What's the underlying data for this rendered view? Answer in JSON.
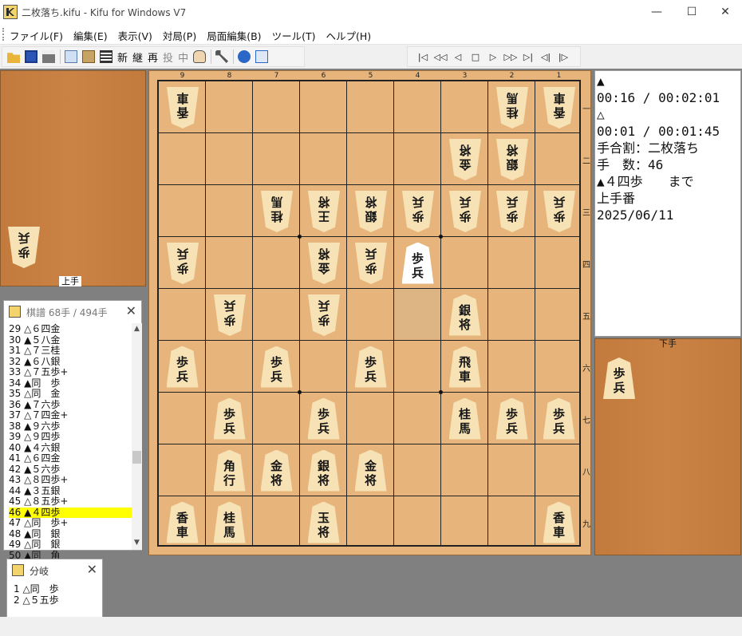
{
  "window": {
    "title": "二枚落ち.kifu - Kifu for Windows V7",
    "min": "—",
    "max": "☐",
    "close": "✕"
  },
  "menu": [
    "ファイル(F)",
    "編集(E)",
    "表示(V)",
    "対局(P)",
    "局面編集(B)",
    "ツール(T)",
    "ヘルプ(H)"
  ],
  "toolbar": {
    "text_buttons": [
      {
        "label": "新",
        "enabled": true
      },
      {
        "label": "継",
        "enabled": true
      },
      {
        "label": "再",
        "enabled": true
      },
      {
        "label": "投",
        "enabled": false
      },
      {
        "label": "中",
        "enabled": false
      }
    ],
    "nav": [
      "|◁",
      "◁◁",
      "◁",
      "□",
      "▷",
      "▷▷",
      "▷|",
      "◁|",
      "|▷"
    ]
  },
  "board": {
    "col_numbers": [
      "9",
      "8",
      "7",
      "6",
      "5",
      "4",
      "3",
      "2",
      "1"
    ],
    "row_numbers": [
      "一",
      "二",
      "三",
      "四",
      "五",
      "六",
      "七",
      "八",
      "九"
    ],
    "pieces": [
      {
        "file": 9,
        "rank": 1,
        "k": [
          "香",
          "車"
        ],
        "side": "gote"
      },
      {
        "file": 2,
        "rank": 1,
        "k": [
          "桂",
          "馬"
        ],
        "side": "gote"
      },
      {
        "file": 1,
        "rank": 1,
        "k": [
          "香",
          "車"
        ],
        "side": "gote"
      },
      {
        "file": 3,
        "rank": 2,
        "k": [
          "金",
          "将"
        ],
        "side": "gote"
      },
      {
        "file": 2,
        "rank": 2,
        "k": [
          "銀",
          "将"
        ],
        "side": "gote"
      },
      {
        "file": 7,
        "rank": 3,
        "k": [
          "桂",
          "馬"
        ],
        "side": "gote"
      },
      {
        "file": 6,
        "rank": 3,
        "k": [
          "王",
          "将"
        ],
        "side": "gote"
      },
      {
        "file": 5,
        "rank": 3,
        "k": [
          "銀",
          "将"
        ],
        "side": "gote"
      },
      {
        "file": 4,
        "rank": 3,
        "k": [
          "歩",
          "兵"
        ],
        "side": "gote"
      },
      {
        "file": 3,
        "rank": 3,
        "k": [
          "歩",
          "兵"
        ],
        "side": "gote"
      },
      {
        "file": 2,
        "rank": 3,
        "k": [
          "歩",
          "兵"
        ],
        "side": "gote"
      },
      {
        "file": 1,
        "rank": 3,
        "k": [
          "歩",
          "兵"
        ],
        "side": "gote"
      },
      {
        "file": 9,
        "rank": 4,
        "k": [
          "歩",
          "兵"
        ],
        "side": "gote"
      },
      {
        "file": 6,
        "rank": 4,
        "k": [
          "金",
          "将"
        ],
        "side": "gote"
      },
      {
        "file": 5,
        "rank": 4,
        "k": [
          "歩",
          "兵"
        ],
        "side": "gote"
      },
      {
        "file": 4,
        "rank": 4,
        "k": [
          "歩",
          "兵"
        ],
        "side": "sente",
        "hl": true
      },
      {
        "file": 8,
        "rank": 5,
        "k": [
          "歩",
          "兵"
        ],
        "side": "gote"
      },
      {
        "file": 6,
        "rank": 5,
        "k": [
          "歩",
          "兵"
        ],
        "side": "gote"
      },
      {
        "file": 3,
        "rank": 5,
        "k": [
          "銀",
          "将"
        ],
        "side": "sente"
      },
      {
        "file": 9,
        "rank": 6,
        "k": [
          "歩",
          "兵"
        ],
        "side": "sente"
      },
      {
        "file": 7,
        "rank": 6,
        "k": [
          "歩",
          "兵"
        ],
        "side": "sente"
      },
      {
        "file": 5,
        "rank": 6,
        "k": [
          "歩",
          "兵"
        ],
        "side": "sente"
      },
      {
        "file": 3,
        "rank": 6,
        "k": [
          "飛",
          "車"
        ],
        "side": "sente"
      },
      {
        "file": 8,
        "rank": 7,
        "k": [
          "歩",
          "兵"
        ],
        "side": "sente"
      },
      {
        "file": 6,
        "rank": 7,
        "k": [
          "歩",
          "兵"
        ],
        "side": "sente"
      },
      {
        "file": 3,
        "rank": 7,
        "k": [
          "桂",
          "馬"
        ],
        "side": "sente"
      },
      {
        "file": 2,
        "rank": 7,
        "k": [
          "歩",
          "兵"
        ],
        "side": "sente"
      },
      {
        "file": 1,
        "rank": 7,
        "k": [
          "歩",
          "兵"
        ],
        "side": "sente"
      },
      {
        "file": 8,
        "rank": 8,
        "k": [
          "角",
          "行"
        ],
        "side": "sente"
      },
      {
        "file": 7,
        "rank": 8,
        "k": [
          "金",
          "将"
        ],
        "side": "sente"
      },
      {
        "file": 6,
        "rank": 8,
        "k": [
          "銀",
          "将"
        ],
        "side": "sente"
      },
      {
        "file": 5,
        "rank": 8,
        "k": [
          "金",
          "将"
        ],
        "side": "sente"
      },
      {
        "file": 9,
        "rank": 9,
        "k": [
          "香",
          "車"
        ],
        "side": "sente"
      },
      {
        "file": 8,
        "rank": 9,
        "k": [
          "桂",
          "馬"
        ],
        "side": "sente"
      },
      {
        "file": 6,
        "rank": 9,
        "k": [
          "玉",
          "将"
        ],
        "side": "sente"
      },
      {
        "file": 1,
        "rank": 9,
        "k": [
          "香",
          "車"
        ],
        "side": "sente"
      }
    ]
  },
  "gote_hand": {
    "label": "上手",
    "pieces": [
      [
        "歩",
        "兵"
      ]
    ]
  },
  "sente_hand": {
    "label": "下手",
    "pieces": [
      [
        "歩",
        "兵"
      ]
    ]
  },
  "info": {
    "lines": [
      "▲",
      "00:16 / 00:02:01",
      "△",
      "00:01 / 00:01:45",
      "手合割：二枚落ち",
      "手　数：46",
      "▲４四歩　　まで",
      "上手番",
      "2025/06/11"
    ]
  },
  "kifu": {
    "title": "棋譜 68手 / 494手",
    "close": "✕",
    "current": 46,
    "moves": [
      "29 △６四金",
      "30 ▲５八金",
      "31 △７三桂",
      "32 ▲６八銀",
      "33 △７五歩+",
      "34 ▲同　歩",
      "35 △同　金",
      "36 ▲７六歩",
      "37 △７四金+",
      "38 ▲９六歩",
      "39 △９四歩",
      "40 ▲４六銀",
      "41 △６四金",
      "42 ▲５六歩",
      "43 △８四歩+",
      "44 ▲３五銀",
      "45 △８五歩+",
      "46 ▲４四歩",
      "47 △同　歩+",
      "48 ▲同　銀",
      "49 △同　銀",
      "50 ▲同　角"
    ],
    "scroll_up": "▲",
    "scroll_down": "▼"
  },
  "branch": {
    "title": "分岐",
    "close": "✕",
    "moves": [
      "1 △同　歩",
      "2 △５五歩"
    ]
  }
}
